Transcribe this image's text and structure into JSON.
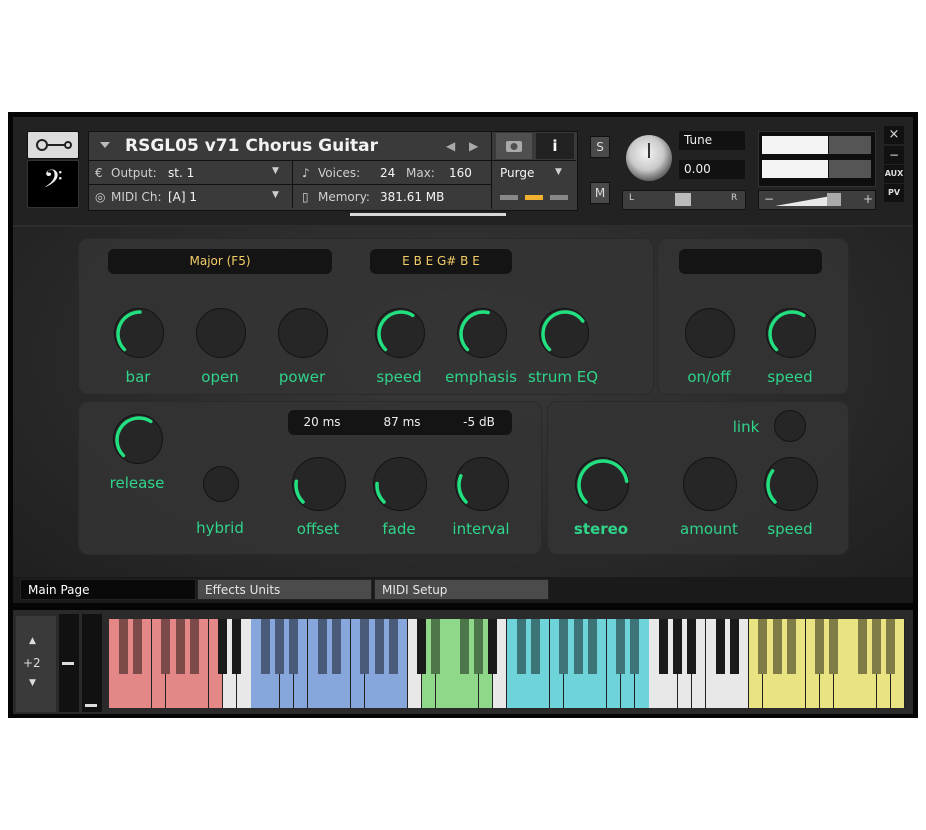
{
  "header": {
    "title": "RSGL05 v71 Chorus Guitar",
    "output_label": "Output:",
    "output_value": "st. 1",
    "voices_label": "Voices:",
    "voices_value": "24",
    "max_label": "Max:",
    "max_value": "160",
    "purge_label": "Purge",
    "midi_label": "MIDI Ch:",
    "midi_value": "[A]  1",
    "memory_label": "Memory:",
    "memory_value": "381.61 MB",
    "s_label": "S",
    "m_label": "M",
    "tune_label": "Tune",
    "tune_value": "0.00",
    "pan_left": "L",
    "pan_right": "R",
    "vol_minus": "−",
    "vol_plus": "+",
    "info_label": "i",
    "close_label": "×",
    "min_label": "−",
    "aux_label": "AUX",
    "pv_label": "PV"
  },
  "chord_panel": {
    "chord_display": "Major (F5)",
    "notes_display": "E B E G# B E",
    "knobs": [
      {
        "label": "bar",
        "value": 0.5
      },
      {
        "label": "open",
        "value": 0
      },
      {
        "label": "power",
        "value": 0
      },
      {
        "label": "speed",
        "value": 0.62
      },
      {
        "label": "emphasis",
        "value": 0.55
      },
      {
        "label": "strum EQ",
        "value": 0.7
      }
    ]
  },
  "mod_panel": {
    "display": "",
    "knobs": [
      {
        "label": "on/off",
        "value": 0
      },
      {
        "label": "speed",
        "value": 0.62
      }
    ]
  },
  "time_panel": {
    "offset_display": "20 ms",
    "fade_display": "87 ms",
    "interval_display": "-5 dB",
    "knobs": [
      {
        "label": "release",
        "value": 0.62
      },
      {
        "label": "hybrid",
        "value": 0
      },
      {
        "label": "offset",
        "value": 0.2
      },
      {
        "label": "fade",
        "value": 0.18
      },
      {
        "label": "interval",
        "value": 0.25
      }
    ]
  },
  "stereo_panel": {
    "link_label": "link",
    "knobs": [
      {
        "label": "stereo",
        "value": 0.8
      },
      {
        "label": "amount",
        "value": 0
      },
      {
        "label": "speed",
        "value": 0.3
      }
    ]
  },
  "tabs": [
    {
      "label": "Main Page",
      "active": true
    },
    {
      "label": "Effects Units",
      "active": false
    },
    {
      "label": "MIDI Setup",
      "active": false
    }
  ],
  "keyboard": {
    "octave_shift": "+2",
    "colors": {
      "red": "#e48787",
      "blue": "#86a6dc",
      "green": "#8fd88a",
      "cyan": "#6fd4d9",
      "yellow": "#e9e381",
      "white": "#e8e8e8",
      "black": "#1a1a1a"
    }
  },
  "colors": {
    "accent": "#22e07f",
    "label": "#2fd48a",
    "lcd_text": "#f3cc66"
  }
}
